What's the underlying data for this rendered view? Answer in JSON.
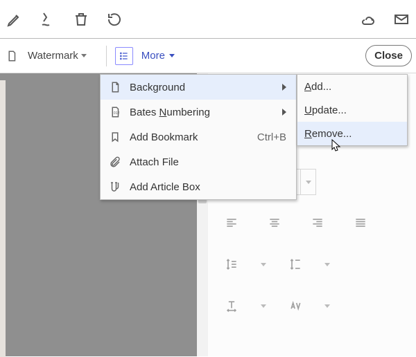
{
  "toolbar": {
    "watermark_label": "Watermark",
    "more_label": "More",
    "close_label": "Close"
  },
  "more_menu": {
    "items": [
      {
        "icon": "page-icon",
        "label": "Background",
        "has_sub": true,
        "highlight": true
      },
      {
        "icon": "bates-icon",
        "label": "Bates Numbering",
        "mnemonic_index": 6,
        "has_sub": true
      },
      {
        "icon": "bookmark-icon",
        "label": "Add Bookmark",
        "accel": "Ctrl+B"
      },
      {
        "icon": "attach-icon",
        "label": "Attach File"
      },
      {
        "icon": "article-icon",
        "label": "Add Article Box"
      }
    ]
  },
  "sub_menu": {
    "items": [
      {
        "label": "Add...",
        "mnemonic_index": 0
      },
      {
        "label": "Update...",
        "mnemonic_index": 0
      },
      {
        "label": "Remove...",
        "mnemonic_index": 0,
        "highlight": true
      }
    ]
  }
}
